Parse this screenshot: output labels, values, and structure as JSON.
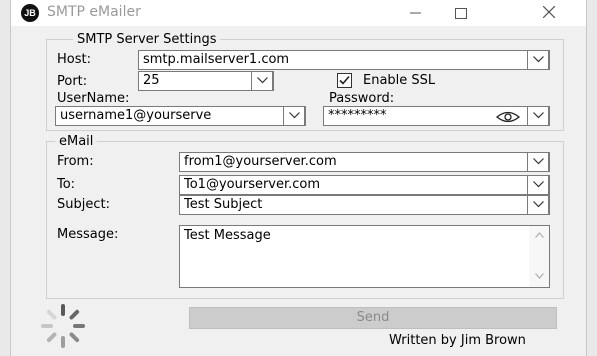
{
  "window": {
    "title": "SMTP eMailer",
    "icon_text": "JB",
    "icon": "app-logo-icon"
  },
  "server": {
    "legend": "SMTP Server Settings",
    "host_label": "Host:",
    "host_value": "smtp.mailserver1.com",
    "port_label": "Port:",
    "port_value": "25",
    "ssl_label": "Enable SSL",
    "ssl_checked": true,
    "username_label": "UserName:",
    "username_value": "username1@yourserve",
    "password_label": "Password:",
    "password_value": "*********"
  },
  "email": {
    "legend": "eMail",
    "from_label": "From:",
    "from_value": "from1@yourserver.com",
    "to_label": "To:",
    "to_value": "To1@yourserver.com",
    "subject_label": "Subject:",
    "subject_value": "Test Subject",
    "message_label": "Message:",
    "message_value": "Test Message"
  },
  "footer": {
    "send_label": "Send",
    "credit": "Written by Jim Brown"
  },
  "colors": {
    "window_bg": "#f0f0f0",
    "field_border": "#7a7a7a",
    "disabled_button": "#cccccc",
    "disabled_text": "#8a8a8a"
  }
}
